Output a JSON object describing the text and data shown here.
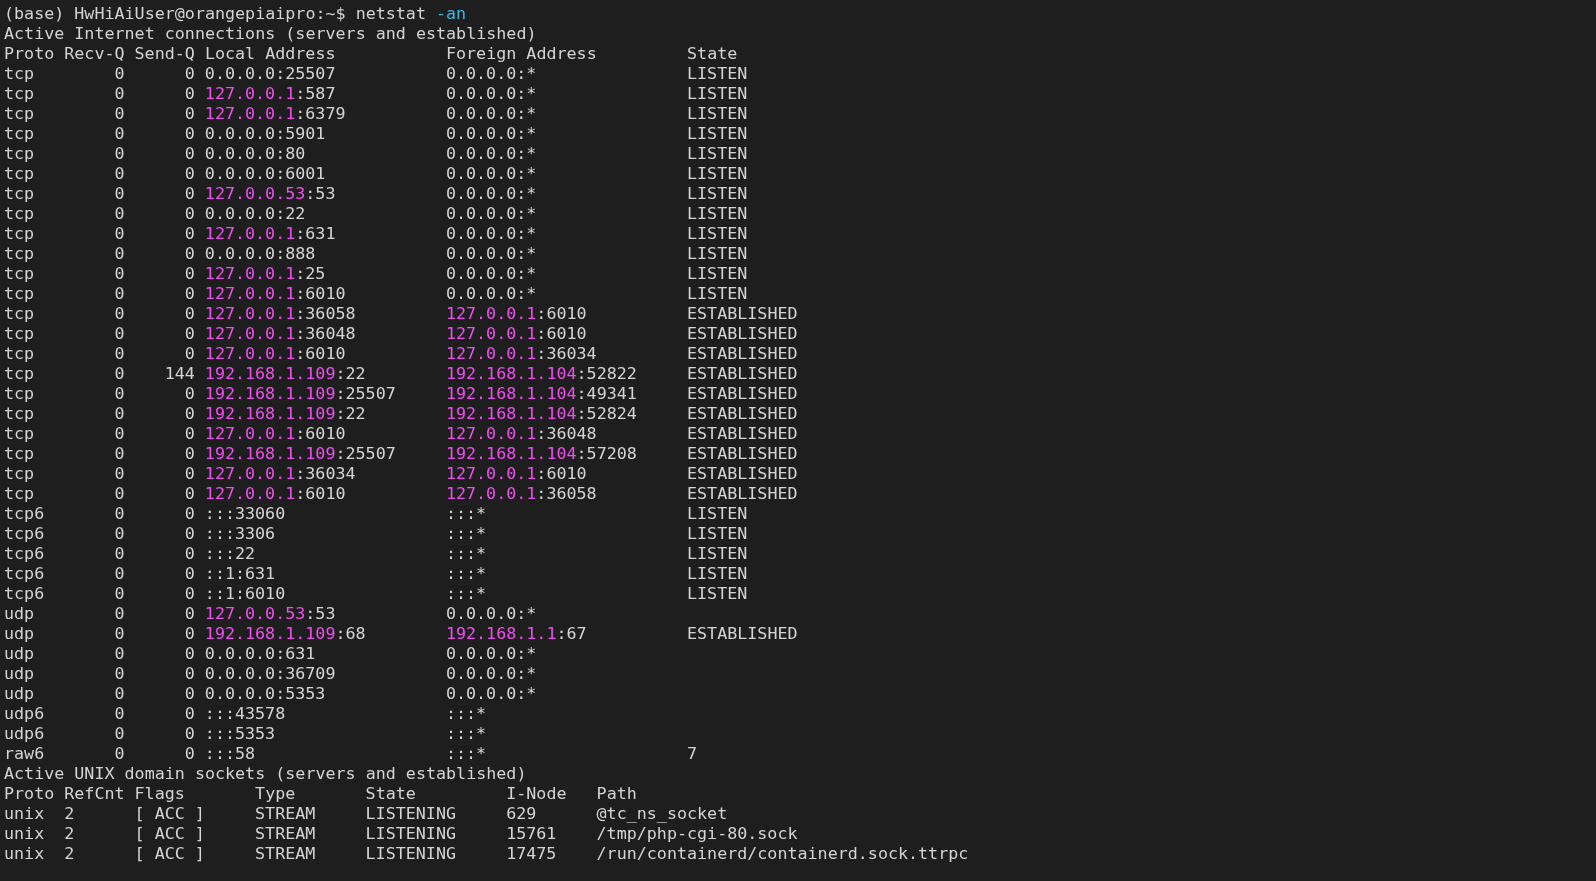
{
  "prompt": {
    "prompt": "(base) HwHiAiUser@orangepiaipro:~$",
    "command": "netstat",
    "option": "-an"
  },
  "inet": {
    "title": "Active Internet connections (servers and established)",
    "columns": [
      "Proto",
      "Recv-Q",
      "Send-Q",
      "Local Address",
      "Foreign Address",
      "State"
    ],
    "rows": [
      {
        "proto": "tcp",
        "recv_q": "0",
        "send_q": "0",
        "local": [
          {
            "text": "0.0.0.0:25507",
            "highlight": false
          }
        ],
        "foreign": [
          {
            "text": "0.0.0.0:*",
            "highlight": false
          }
        ],
        "state": "LISTEN"
      },
      {
        "proto": "tcp",
        "recv_q": "0",
        "send_q": "0",
        "local": [
          {
            "text": "127.0.0.1",
            "highlight": true
          },
          {
            "text": ":587",
            "highlight": false
          }
        ],
        "foreign": [
          {
            "text": "0.0.0.0:*",
            "highlight": false
          }
        ],
        "state": "LISTEN"
      },
      {
        "proto": "tcp",
        "recv_q": "0",
        "send_q": "0",
        "local": [
          {
            "text": "127.0.0.1",
            "highlight": true
          },
          {
            "text": ":6379",
            "highlight": false
          }
        ],
        "foreign": [
          {
            "text": "0.0.0.0:*",
            "highlight": false
          }
        ],
        "state": "LISTEN"
      },
      {
        "proto": "tcp",
        "recv_q": "0",
        "send_q": "0",
        "local": [
          {
            "text": "0.0.0.0:5901",
            "highlight": false
          }
        ],
        "foreign": [
          {
            "text": "0.0.0.0:*",
            "highlight": false
          }
        ],
        "state": "LISTEN"
      },
      {
        "proto": "tcp",
        "recv_q": "0",
        "send_q": "0",
        "local": [
          {
            "text": "0.0.0.0:80",
            "highlight": false
          }
        ],
        "foreign": [
          {
            "text": "0.0.0.0:*",
            "highlight": false
          }
        ],
        "state": "LISTEN"
      },
      {
        "proto": "tcp",
        "recv_q": "0",
        "send_q": "0",
        "local": [
          {
            "text": "0.0.0.0:6001",
            "highlight": false
          }
        ],
        "foreign": [
          {
            "text": "0.0.0.0:*",
            "highlight": false
          }
        ],
        "state": "LISTEN"
      },
      {
        "proto": "tcp",
        "recv_q": "0",
        "send_q": "0",
        "local": [
          {
            "text": "127.0.0.53",
            "highlight": true
          },
          {
            "text": ":53",
            "highlight": false
          }
        ],
        "foreign": [
          {
            "text": "0.0.0.0:*",
            "highlight": false
          }
        ],
        "state": "LISTEN"
      },
      {
        "proto": "tcp",
        "recv_q": "0",
        "send_q": "0",
        "local": [
          {
            "text": "0.0.0.0:22",
            "highlight": false
          }
        ],
        "foreign": [
          {
            "text": "0.0.0.0:*",
            "highlight": false
          }
        ],
        "state": "LISTEN"
      },
      {
        "proto": "tcp",
        "recv_q": "0",
        "send_q": "0",
        "local": [
          {
            "text": "127.0.0.1",
            "highlight": true
          },
          {
            "text": ":631",
            "highlight": false
          }
        ],
        "foreign": [
          {
            "text": "0.0.0.0:*",
            "highlight": false
          }
        ],
        "state": "LISTEN"
      },
      {
        "proto": "tcp",
        "recv_q": "0",
        "send_q": "0",
        "local": [
          {
            "text": "0.0.0.0:888",
            "highlight": false
          }
        ],
        "foreign": [
          {
            "text": "0.0.0.0:*",
            "highlight": false
          }
        ],
        "state": "LISTEN"
      },
      {
        "proto": "tcp",
        "recv_q": "0",
        "send_q": "0",
        "local": [
          {
            "text": "127.0.0.1",
            "highlight": true
          },
          {
            "text": ":25",
            "highlight": false
          }
        ],
        "foreign": [
          {
            "text": "0.0.0.0:*",
            "highlight": false
          }
        ],
        "state": "LISTEN"
      },
      {
        "proto": "tcp",
        "recv_q": "0",
        "send_q": "0",
        "local": [
          {
            "text": "127.0.0.1",
            "highlight": true
          },
          {
            "text": ":6010",
            "highlight": false
          }
        ],
        "foreign": [
          {
            "text": "0.0.0.0:*",
            "highlight": false
          }
        ],
        "state": "LISTEN"
      },
      {
        "proto": "tcp",
        "recv_q": "0",
        "send_q": "0",
        "local": [
          {
            "text": "127.0.0.1",
            "highlight": true
          },
          {
            "text": ":36058",
            "highlight": false
          }
        ],
        "foreign": [
          {
            "text": "127.0.0.1",
            "highlight": true
          },
          {
            "text": ":6010",
            "highlight": false
          }
        ],
        "state": "ESTABLISHED"
      },
      {
        "proto": "tcp",
        "recv_q": "0",
        "send_q": "0",
        "local": [
          {
            "text": "127.0.0.1",
            "highlight": true
          },
          {
            "text": ":36048",
            "highlight": false
          }
        ],
        "foreign": [
          {
            "text": "127.0.0.1",
            "highlight": true
          },
          {
            "text": ":6010",
            "highlight": false
          }
        ],
        "state": "ESTABLISHED"
      },
      {
        "proto": "tcp",
        "recv_q": "0",
        "send_q": "0",
        "local": [
          {
            "text": "127.0.0.1",
            "highlight": true
          },
          {
            "text": ":6010",
            "highlight": false
          }
        ],
        "foreign": [
          {
            "text": "127.0.0.1",
            "highlight": true
          },
          {
            "text": ":36034",
            "highlight": false
          }
        ],
        "state": "ESTABLISHED"
      },
      {
        "proto": "tcp",
        "recv_q": "0",
        "send_q": "144",
        "local": [
          {
            "text": "192.168.1.109",
            "highlight": true
          },
          {
            "text": ":22",
            "highlight": false
          }
        ],
        "foreign": [
          {
            "text": "192.168.1.104",
            "highlight": true
          },
          {
            "text": ":52822",
            "highlight": false
          }
        ],
        "state": "ESTABLISHED"
      },
      {
        "proto": "tcp",
        "recv_q": "0",
        "send_q": "0",
        "local": [
          {
            "text": "192.168.1.109",
            "highlight": true
          },
          {
            "text": ":25507",
            "highlight": false
          }
        ],
        "foreign": [
          {
            "text": "192.168.1.104",
            "highlight": true
          },
          {
            "text": ":49341",
            "highlight": false
          }
        ],
        "state": "ESTABLISHED"
      },
      {
        "proto": "tcp",
        "recv_q": "0",
        "send_q": "0",
        "local": [
          {
            "text": "192.168.1.109",
            "highlight": true
          },
          {
            "text": ":22",
            "highlight": false
          }
        ],
        "foreign": [
          {
            "text": "192.168.1.104",
            "highlight": true
          },
          {
            "text": ":52824",
            "highlight": false
          }
        ],
        "state": "ESTABLISHED"
      },
      {
        "proto": "tcp",
        "recv_q": "0",
        "send_q": "0",
        "local": [
          {
            "text": "127.0.0.1",
            "highlight": true
          },
          {
            "text": ":6010",
            "highlight": false
          }
        ],
        "foreign": [
          {
            "text": "127.0.0.1",
            "highlight": true
          },
          {
            "text": ":36048",
            "highlight": false
          }
        ],
        "state": "ESTABLISHED"
      },
      {
        "proto": "tcp",
        "recv_q": "0",
        "send_q": "0",
        "local": [
          {
            "text": "192.168.1.109",
            "highlight": true
          },
          {
            "text": ":25507",
            "highlight": false
          }
        ],
        "foreign": [
          {
            "text": "192.168.1.104",
            "highlight": true
          },
          {
            "text": ":57208",
            "highlight": false
          }
        ],
        "state": "ESTABLISHED"
      },
      {
        "proto": "tcp",
        "recv_q": "0",
        "send_q": "0",
        "local": [
          {
            "text": "127.0.0.1",
            "highlight": true
          },
          {
            "text": ":36034",
            "highlight": false
          }
        ],
        "foreign": [
          {
            "text": "127.0.0.1",
            "highlight": true
          },
          {
            "text": ":6010",
            "highlight": false
          }
        ],
        "state": "ESTABLISHED"
      },
      {
        "proto": "tcp",
        "recv_q": "0",
        "send_q": "0",
        "local": [
          {
            "text": "127.0.0.1",
            "highlight": true
          },
          {
            "text": ":6010",
            "highlight": false
          }
        ],
        "foreign": [
          {
            "text": "127.0.0.1",
            "highlight": true
          },
          {
            "text": ":36058",
            "highlight": false
          }
        ],
        "state": "ESTABLISHED"
      },
      {
        "proto": "tcp6",
        "recv_q": "0",
        "send_q": "0",
        "local": [
          {
            "text": ":::33060",
            "highlight": false
          }
        ],
        "foreign": [
          {
            "text": ":::*",
            "highlight": false
          }
        ],
        "state": "LISTEN"
      },
      {
        "proto": "tcp6",
        "recv_q": "0",
        "send_q": "0",
        "local": [
          {
            "text": ":::3306",
            "highlight": false
          }
        ],
        "foreign": [
          {
            "text": ":::*",
            "highlight": false
          }
        ],
        "state": "LISTEN"
      },
      {
        "proto": "tcp6",
        "recv_q": "0",
        "send_q": "0",
        "local": [
          {
            "text": ":::22",
            "highlight": false
          }
        ],
        "foreign": [
          {
            "text": ":::*",
            "highlight": false
          }
        ],
        "state": "LISTEN"
      },
      {
        "proto": "tcp6",
        "recv_q": "0",
        "send_q": "0",
        "local": [
          {
            "text": "::1:631",
            "highlight": false
          }
        ],
        "foreign": [
          {
            "text": ":::*",
            "highlight": false
          }
        ],
        "state": "LISTEN"
      },
      {
        "proto": "tcp6",
        "recv_q": "0",
        "send_q": "0",
        "local": [
          {
            "text": "::1:6010",
            "highlight": false
          }
        ],
        "foreign": [
          {
            "text": ":::*",
            "highlight": false
          }
        ],
        "state": "LISTEN"
      },
      {
        "proto": "udp",
        "recv_q": "0",
        "send_q": "0",
        "local": [
          {
            "text": "127.0.0.53",
            "highlight": true
          },
          {
            "text": ":53",
            "highlight": false
          }
        ],
        "foreign": [
          {
            "text": "0.0.0.0:*",
            "highlight": false
          }
        ]
      },
      {
        "proto": "udp",
        "recv_q": "0",
        "send_q": "0",
        "local": [
          {
            "text": "192.168.1.109",
            "highlight": true
          },
          {
            "text": ":68",
            "highlight": false
          }
        ],
        "foreign": [
          {
            "text": "192.168.1.1",
            "highlight": true
          },
          {
            "text": ":67",
            "highlight": false
          }
        ],
        "state": "ESTABLISHED"
      },
      {
        "proto": "udp",
        "recv_q": "0",
        "send_q": "0",
        "local": [
          {
            "text": "0.0.0.0:631",
            "highlight": false
          }
        ],
        "foreign": [
          {
            "text": "0.0.0.0:*",
            "highlight": false
          }
        ]
      },
      {
        "proto": "udp",
        "recv_q": "0",
        "send_q": "0",
        "local": [
          {
            "text": "0.0.0.0:36709",
            "highlight": false
          }
        ],
        "foreign": [
          {
            "text": "0.0.0.0:*",
            "highlight": false
          }
        ]
      },
      {
        "proto": "udp",
        "recv_q": "0",
        "send_q": "0",
        "local": [
          {
            "text": "0.0.0.0:5353",
            "highlight": false
          }
        ],
        "foreign": [
          {
            "text": "0.0.0.0:*",
            "highlight": false
          }
        ]
      },
      {
        "proto": "udp6",
        "recv_q": "0",
        "send_q": "0",
        "local": [
          {
            "text": ":::43578",
            "highlight": false
          }
        ],
        "foreign": [
          {
            "text": ":::*",
            "highlight": false
          }
        ]
      },
      {
        "proto": "udp6",
        "recv_q": "0",
        "send_q": "0",
        "local": [
          {
            "text": ":::5353",
            "highlight": false
          }
        ],
        "foreign": [
          {
            "text": ":::*",
            "highlight": false
          }
        ]
      },
      {
        "proto": "raw6",
        "recv_q": "0",
        "send_q": "0",
        "local": [
          {
            "text": ":::58",
            "highlight": false
          }
        ],
        "foreign": [
          {
            "text": ":::*",
            "highlight": false
          }
        ],
        "state": "7"
      }
    ]
  },
  "unix": {
    "title": "Active UNIX domain sockets (servers and established)",
    "columns": [
      "Proto",
      "RefCnt",
      "Flags",
      "Type",
      "State",
      "I-Node",
      "Path"
    ],
    "rows": [
      {
        "proto": "unix",
        "refcnt": "2",
        "flags": "[ ACC ]",
        "type": "STREAM",
        "state": "LISTENING",
        "inode": "629",
        "path": "@tc_ns_socket"
      },
      {
        "proto": "unix",
        "refcnt": "2",
        "flags": "[ ACC ]",
        "type": "STREAM",
        "state": "LISTENING",
        "inode": "15761",
        "path": "/tmp/php-cgi-80.sock"
      },
      {
        "proto": "unix",
        "refcnt": "2",
        "flags": "[ ACC ]",
        "type": "STREAM",
        "state": "LISTENING",
        "inode": "17475",
        "path": "/run/containerd/containerd.sock.ttrpc"
      }
    ]
  }
}
